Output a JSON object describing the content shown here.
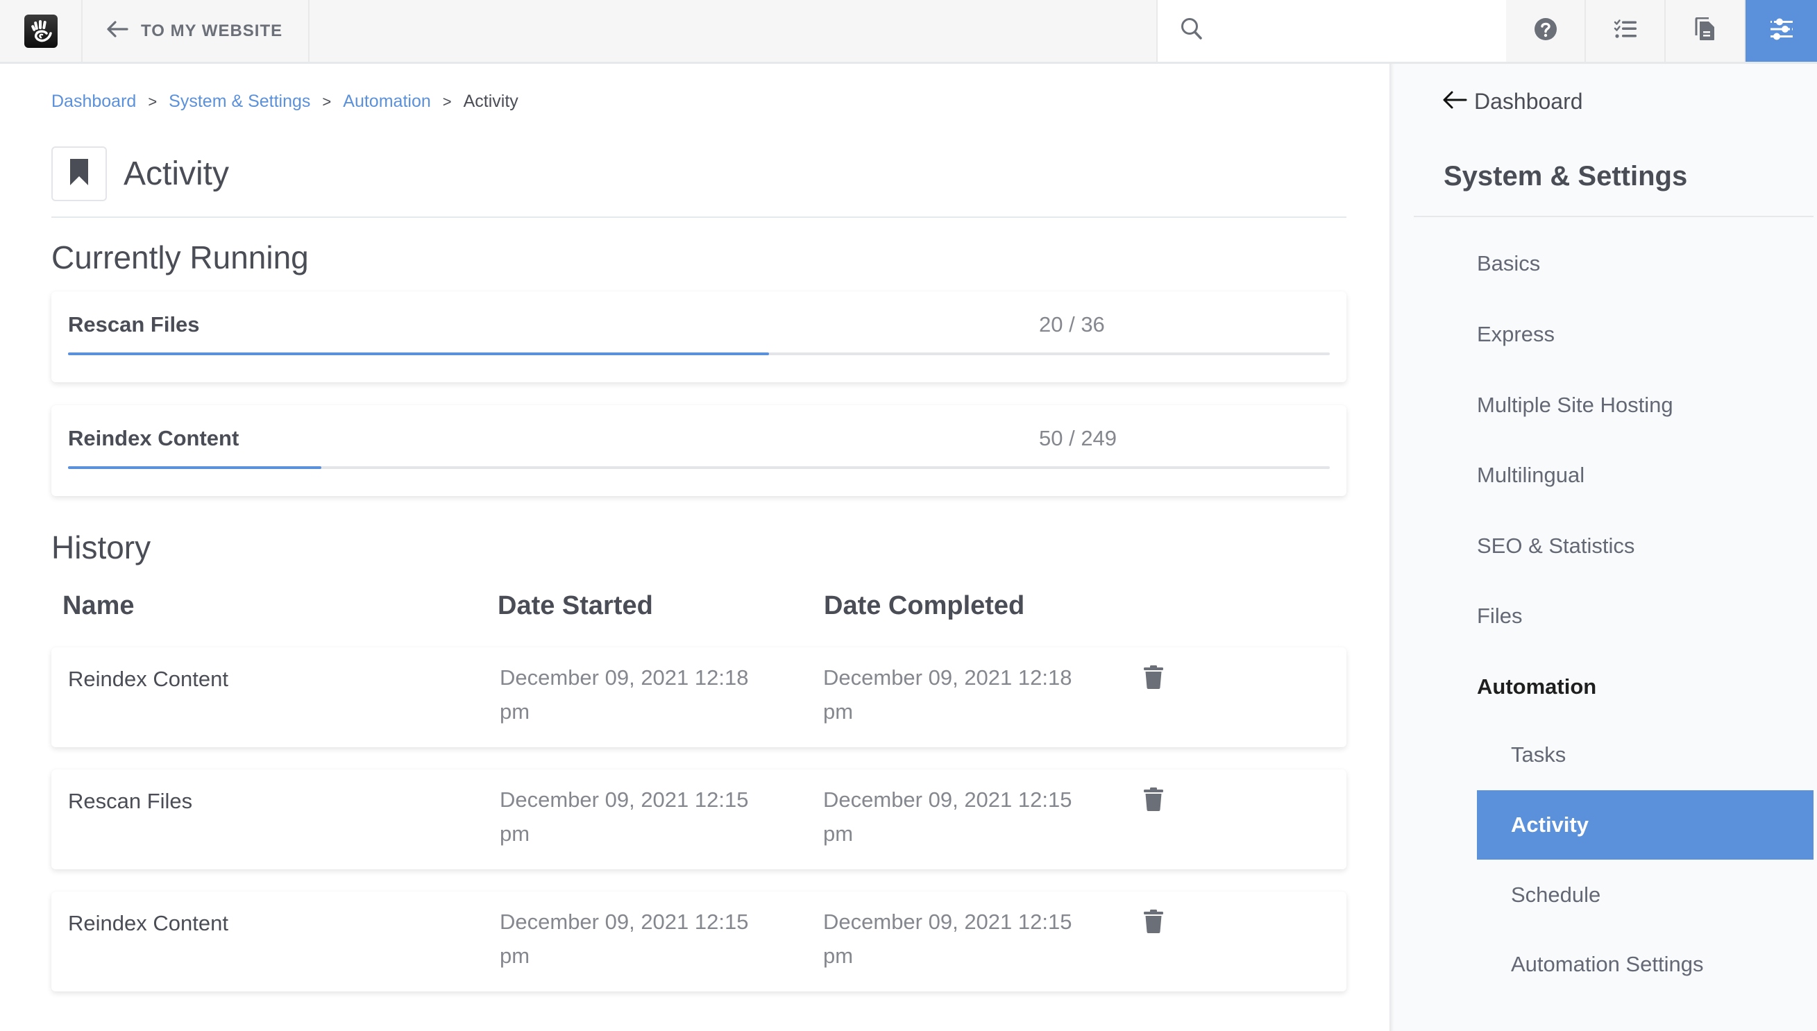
{
  "header": {
    "logo_icon": "concrete-cms-hand-logo",
    "back_label": "TO MY WEBSITE",
    "back_icon": "arrow-left-icon",
    "search_placeholder": "",
    "search_value": "",
    "icons": {
      "help": "question-circle-icon",
      "tasks": "checklist-icon",
      "pages": "copy-document-icon",
      "settings": "sliders-icon"
    },
    "accent_color": "#5b90db"
  },
  "breadcrumb": {
    "items": [
      {
        "label": "Dashboard",
        "link": true
      },
      {
        "label": "System & Settings",
        "link": true
      },
      {
        "label": "Automation",
        "link": true
      },
      {
        "label": "Activity",
        "link": false
      }
    ],
    "separator": ">"
  },
  "page": {
    "title": "Activity",
    "title_icon": "bookmark-icon"
  },
  "running": {
    "heading": "Currently Running",
    "tasks": [
      {
        "name": "Rescan Files",
        "done": 20,
        "total": 36,
        "count_label": "20 / 36"
      },
      {
        "name": "Reindex Content",
        "done": 50,
        "total": 249,
        "count_label": "50 / 249"
      }
    ]
  },
  "history": {
    "heading": "History",
    "columns": [
      "Name",
      "Date Started",
      "Date Completed"
    ],
    "rows": [
      {
        "name": "Reindex Content",
        "started": "December 09, 2021 12:18 pm",
        "completed": "December 09, 2021 12:18 pm"
      },
      {
        "name": "Rescan Files",
        "started": "December 09, 2021 12:15 pm",
        "completed": "December 09, 2021 12:15 pm"
      },
      {
        "name": "Reindex Content",
        "started": "December 09, 2021 12:15 pm",
        "completed": "December 09, 2021 12:15 pm"
      }
    ],
    "delete_icon": "trash-icon"
  },
  "sidebar": {
    "back_label": "Dashboard",
    "title": "System & Settings",
    "items": [
      {
        "label": "Basics"
      },
      {
        "label": "Express"
      },
      {
        "label": "Multiple Site Hosting"
      },
      {
        "label": "Multilingual"
      },
      {
        "label": "SEO & Statistics"
      },
      {
        "label": "Files"
      },
      {
        "label": "Automation",
        "expanded": true
      },
      {
        "label": "Tasks",
        "child": true
      },
      {
        "label": "Activity",
        "child": true,
        "active": true
      },
      {
        "label": "Schedule",
        "child": true
      },
      {
        "label": "Automation Settings",
        "child": true
      }
    ]
  }
}
